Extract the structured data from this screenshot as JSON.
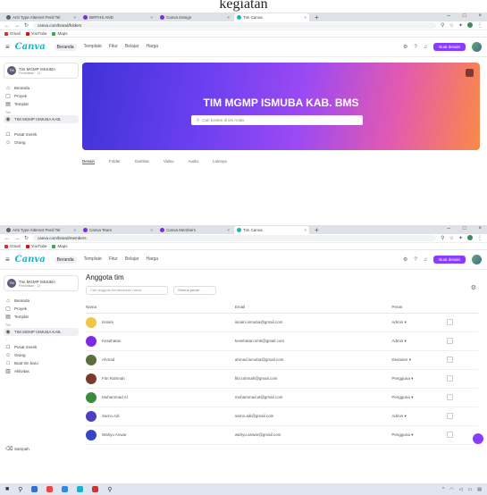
{
  "caption": "kegiatan",
  "browser1": {
    "tabs": [
      "Anti Type Alternet Penil Tel",
      "BIRTHS AND",
      "Canva Design",
      "Tim Canva"
    ],
    "url": "canva.com/brand/folders",
    "bookmarks": [
      "Gmail",
      "YouTube",
      "Maps"
    ]
  },
  "browser2": {
    "tabs": [
      "Anti Type Alternet Penil Tel",
      "Canva Team",
      "Canva Members",
      "Tim Canva"
    ],
    "url": "canva.com/brand/members",
    "bookmarks": [
      "Gmail",
      "YouTube",
      "Maps"
    ]
  },
  "canva": {
    "logo": "Canva",
    "nav": [
      "Beranda",
      "Template",
      "Fitur",
      "Belajar",
      "Harga"
    ],
    "create_label": "Buat desain",
    "team_name": "Tim MGMP ISMUBA",
    "team_sub": "Pendidikan · 12",
    "sidebar": [
      "Beranda",
      "Proyek",
      "Templat"
    ],
    "sidebar_team_label": "Tim",
    "sidebar_team": "TIM MGMP ISMUBA KAB.",
    "sidebar2_extra": [
      "Pusat merek",
      "Orang",
      "Buat tim baru",
      "Aktivitas"
    ],
    "sidebar1_extra": [
      "Pusat merek",
      "Orang"
    ],
    "sidebar_trash": "Sampah"
  },
  "hero": {
    "title": "TIM MGMP ISMUBA KAB. BMS",
    "search_placeholder": "Cari konten di tim Anda",
    "tabs": [
      "Desain",
      "Folder",
      "Gambar",
      "Video",
      "Audio",
      "Lainnya"
    ]
  },
  "members": {
    "title": "Anggota tim",
    "search_placeholder": "Cari anggota berdasarkan nama",
    "filter": "Semua peran",
    "headers": [
      "Nama",
      "Email",
      "Peran"
    ],
    "rows": [
      {
        "name": "Isnaini",
        "email": "isnaini.ismuba@gmail.com",
        "role": "Admin",
        "color": "#f4c542"
      },
      {
        "name": "Kesehatan",
        "email": "kesehatan.smk@gmail.com",
        "role": "Admin",
        "color": "#7d2ae8"
      },
      {
        "name": "Ahmad",
        "email": "ahmad.ismuba@gmail.com",
        "role": "Desainer",
        "color": "#5a6f3d"
      },
      {
        "name": "Fitri Rahmah",
        "email": "fitri.rahmah@gmail.com",
        "role": "Pengguna",
        "color": "#7a3b2e"
      },
      {
        "name": "Muhammad Al",
        "email": "muhammad.al@gmail.com",
        "role": "Pengguna",
        "color": "#3c8b3c"
      },
      {
        "name": "Sarno Adi",
        "email": "sarno.adi@gmail.com",
        "role": "Admin",
        "color": "#4b3fc2"
      },
      {
        "name": "Wahyu Anwar",
        "email": "wahyu.anwar@gmail.com",
        "role": "Pengguna",
        "color": "#3447c2"
      }
    ]
  }
}
